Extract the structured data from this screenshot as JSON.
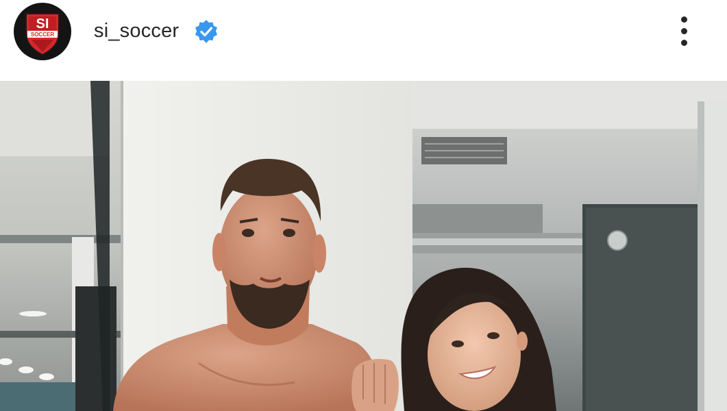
{
  "post": {
    "header": {
      "username": "si_soccer",
      "verified": true,
      "avatar_logo_text": {
        "line1": "SI",
        "line2": "SOCCER"
      }
    },
    "icons": {
      "verified": "verified-badge-icon",
      "more": "more-options-icon"
    },
    "colors": {
      "verified_blue": "#3897f0",
      "avatar_red": "#d9262b",
      "avatar_bg": "#141414",
      "text": "#262626"
    }
  }
}
